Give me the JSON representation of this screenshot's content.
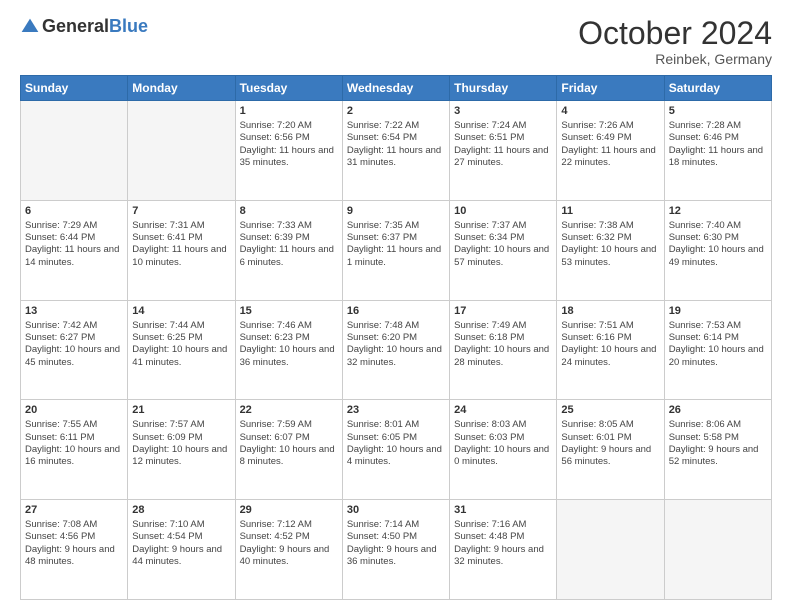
{
  "logo": {
    "general": "General",
    "blue": "Blue"
  },
  "header": {
    "month": "October 2024",
    "location": "Reinbek, Germany"
  },
  "weekdays": [
    "Sunday",
    "Monday",
    "Tuesday",
    "Wednesday",
    "Thursday",
    "Friday",
    "Saturday"
  ],
  "weeks": [
    [
      {
        "day": "",
        "empty": true
      },
      {
        "day": "",
        "empty": true
      },
      {
        "day": "1",
        "sunrise": "Sunrise: 7:20 AM",
        "sunset": "Sunset: 6:56 PM",
        "daylight": "Daylight: 11 hours and 35 minutes."
      },
      {
        "day": "2",
        "sunrise": "Sunrise: 7:22 AM",
        "sunset": "Sunset: 6:54 PM",
        "daylight": "Daylight: 11 hours and 31 minutes."
      },
      {
        "day": "3",
        "sunrise": "Sunrise: 7:24 AM",
        "sunset": "Sunset: 6:51 PM",
        "daylight": "Daylight: 11 hours and 27 minutes."
      },
      {
        "day": "4",
        "sunrise": "Sunrise: 7:26 AM",
        "sunset": "Sunset: 6:49 PM",
        "daylight": "Daylight: 11 hours and 22 minutes."
      },
      {
        "day": "5",
        "sunrise": "Sunrise: 7:28 AM",
        "sunset": "Sunset: 6:46 PM",
        "daylight": "Daylight: 11 hours and 18 minutes."
      }
    ],
    [
      {
        "day": "6",
        "sunrise": "Sunrise: 7:29 AM",
        "sunset": "Sunset: 6:44 PM",
        "daylight": "Daylight: 11 hours and 14 minutes."
      },
      {
        "day": "7",
        "sunrise": "Sunrise: 7:31 AM",
        "sunset": "Sunset: 6:41 PM",
        "daylight": "Daylight: 11 hours and 10 minutes."
      },
      {
        "day": "8",
        "sunrise": "Sunrise: 7:33 AM",
        "sunset": "Sunset: 6:39 PM",
        "daylight": "Daylight: 11 hours and 6 minutes."
      },
      {
        "day": "9",
        "sunrise": "Sunrise: 7:35 AM",
        "sunset": "Sunset: 6:37 PM",
        "daylight": "Daylight: 11 hours and 1 minute."
      },
      {
        "day": "10",
        "sunrise": "Sunrise: 7:37 AM",
        "sunset": "Sunset: 6:34 PM",
        "daylight": "Daylight: 10 hours and 57 minutes."
      },
      {
        "day": "11",
        "sunrise": "Sunrise: 7:38 AM",
        "sunset": "Sunset: 6:32 PM",
        "daylight": "Daylight: 10 hours and 53 minutes."
      },
      {
        "day": "12",
        "sunrise": "Sunrise: 7:40 AM",
        "sunset": "Sunset: 6:30 PM",
        "daylight": "Daylight: 10 hours and 49 minutes."
      }
    ],
    [
      {
        "day": "13",
        "sunrise": "Sunrise: 7:42 AM",
        "sunset": "Sunset: 6:27 PM",
        "daylight": "Daylight: 10 hours and 45 minutes."
      },
      {
        "day": "14",
        "sunrise": "Sunrise: 7:44 AM",
        "sunset": "Sunset: 6:25 PM",
        "daylight": "Daylight: 10 hours and 41 minutes."
      },
      {
        "day": "15",
        "sunrise": "Sunrise: 7:46 AM",
        "sunset": "Sunset: 6:23 PM",
        "daylight": "Daylight: 10 hours and 36 minutes."
      },
      {
        "day": "16",
        "sunrise": "Sunrise: 7:48 AM",
        "sunset": "Sunset: 6:20 PM",
        "daylight": "Daylight: 10 hours and 32 minutes."
      },
      {
        "day": "17",
        "sunrise": "Sunrise: 7:49 AM",
        "sunset": "Sunset: 6:18 PM",
        "daylight": "Daylight: 10 hours and 28 minutes."
      },
      {
        "day": "18",
        "sunrise": "Sunrise: 7:51 AM",
        "sunset": "Sunset: 6:16 PM",
        "daylight": "Daylight: 10 hours and 24 minutes."
      },
      {
        "day": "19",
        "sunrise": "Sunrise: 7:53 AM",
        "sunset": "Sunset: 6:14 PM",
        "daylight": "Daylight: 10 hours and 20 minutes."
      }
    ],
    [
      {
        "day": "20",
        "sunrise": "Sunrise: 7:55 AM",
        "sunset": "Sunset: 6:11 PM",
        "daylight": "Daylight: 10 hours and 16 minutes."
      },
      {
        "day": "21",
        "sunrise": "Sunrise: 7:57 AM",
        "sunset": "Sunset: 6:09 PM",
        "daylight": "Daylight: 10 hours and 12 minutes."
      },
      {
        "day": "22",
        "sunrise": "Sunrise: 7:59 AM",
        "sunset": "Sunset: 6:07 PM",
        "daylight": "Daylight: 10 hours and 8 minutes."
      },
      {
        "day": "23",
        "sunrise": "Sunrise: 8:01 AM",
        "sunset": "Sunset: 6:05 PM",
        "daylight": "Daylight: 10 hours and 4 minutes."
      },
      {
        "day": "24",
        "sunrise": "Sunrise: 8:03 AM",
        "sunset": "Sunset: 6:03 PM",
        "daylight": "Daylight: 10 hours and 0 minutes."
      },
      {
        "day": "25",
        "sunrise": "Sunrise: 8:05 AM",
        "sunset": "Sunset: 6:01 PM",
        "daylight": "Daylight: 9 hours and 56 minutes."
      },
      {
        "day": "26",
        "sunrise": "Sunrise: 8:06 AM",
        "sunset": "Sunset: 5:58 PM",
        "daylight": "Daylight: 9 hours and 52 minutes."
      }
    ],
    [
      {
        "day": "27",
        "sunrise": "Sunrise: 7:08 AM",
        "sunset": "Sunset: 4:56 PM",
        "daylight": "Daylight: 9 hours and 48 minutes."
      },
      {
        "day": "28",
        "sunrise": "Sunrise: 7:10 AM",
        "sunset": "Sunset: 4:54 PM",
        "daylight": "Daylight: 9 hours and 44 minutes."
      },
      {
        "day": "29",
        "sunrise": "Sunrise: 7:12 AM",
        "sunset": "Sunset: 4:52 PM",
        "daylight": "Daylight: 9 hours and 40 minutes."
      },
      {
        "day": "30",
        "sunrise": "Sunrise: 7:14 AM",
        "sunset": "Sunset: 4:50 PM",
        "daylight": "Daylight: 9 hours and 36 minutes."
      },
      {
        "day": "31",
        "sunrise": "Sunrise: 7:16 AM",
        "sunset": "Sunset: 4:48 PM",
        "daylight": "Daylight: 9 hours and 32 minutes."
      },
      {
        "day": "",
        "empty": true
      },
      {
        "day": "",
        "empty": true
      }
    ]
  ]
}
